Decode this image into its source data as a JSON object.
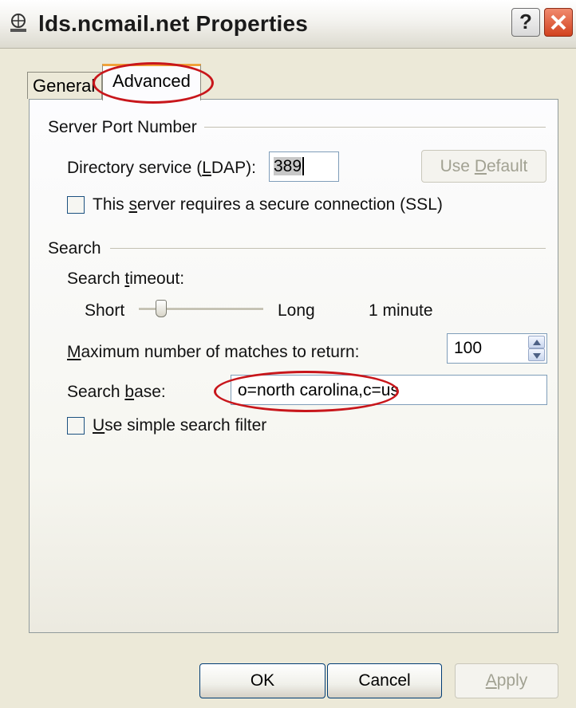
{
  "window": {
    "title": "lds.ncmail.net Properties",
    "help_label": "?",
    "close_label": "✕"
  },
  "tabs": {
    "general": "General",
    "advanced": "Advanced"
  },
  "server_port": {
    "section_label": "Server Port Number",
    "ldap_label_pre": "Directory service (",
    "ldap_label_key": "L",
    "ldap_label_post": "DAP):",
    "ldap_value": "389",
    "use_default_pre": "Use ",
    "use_default_key": "D",
    "use_default_post": "efault",
    "ssl_label_pre": "This ",
    "ssl_label_key": "s",
    "ssl_label_post": "erver requires a secure connection (SSL)",
    "ssl_checked": false
  },
  "search": {
    "section_label": "Search",
    "timeout_label_pre": "Search ",
    "timeout_label_key": "t",
    "timeout_label_post": "imeout:",
    "slider_min_label": "Short",
    "slider_max_label": "Long",
    "slider_value_label": "1 minute",
    "slider_level": 0.15,
    "max_label_key": "M",
    "max_label_post": "aximum number of matches to return:",
    "max_value": "100",
    "base_label_pre": "Search ",
    "base_label_key": "b",
    "base_label_post": "ase:",
    "base_value": "o=north carolina,c=us",
    "simple_filter_key": "U",
    "simple_filter_post": "se simple search filter",
    "simple_filter_checked": false
  },
  "buttons": {
    "ok": "OK",
    "cancel": "Cancel",
    "apply_key": "A",
    "apply_post": "pply"
  },
  "colors": {
    "annotation": "#c8161b",
    "tab_highlight": "#f0a23a",
    "button_border": "#003c74"
  }
}
